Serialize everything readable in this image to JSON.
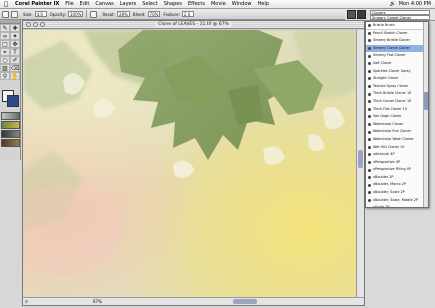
{
  "menubar": {
    "app": "Corel Painter IX",
    "items": [
      "File",
      "Edit",
      "Canvas",
      "Layers",
      "Select",
      "Shapes",
      "Effects",
      "Movie",
      "Window",
      "Help"
    ],
    "clock": "Mon 4:00 PM"
  },
  "propbar": {
    "size_label": "Size:",
    "size_value": "4.0",
    "opacity_label": "Opacity:",
    "opacity_value": "100%",
    "resat_label": "Resat:",
    "resat_value": "28%",
    "bleed_label": "Bleed:",
    "bleed_value": "70%",
    "feature_label": "Feature:",
    "feature_value": "2.0"
  },
  "brush_selector": {
    "category": "Cloners",
    "variant": "Smeary Camel Cloner"
  },
  "document": {
    "title": "Clone of LEAVES - 11.tif @ 67%",
    "zoom": "67%"
  },
  "brush_list": {
    "items": [
      "Bristle Brush",
      "Pencil Sketch Cloner",
      "Smeary Bristle Cloner",
      "Smeary Camel Cloner",
      "Smeary Flat Cloner",
      "Soft Cloner",
      "Sparkles Cloner Spray",
      "Straight Cloner",
      "Texture Spray Cloner",
      "Thick Bristle Cloner 10",
      "Thick Camel Cloner 10",
      "Thick Flat Cloner 10",
      "Van Gogh Cloner",
      "Watercolor Cloner",
      "Watercolor Run Cloner",
      "Watercolor Wash Cloner",
      "Wet Oils Cloner 10",
      "xAirbrush 4P",
      "xPerspective 4P",
      "xPerspective Filling 4P",
      "xBoulder 2P",
      "xBoulder, Marco 2P",
      "xBoulder, Scale 2P",
      "xBoulder, Scale, Rotate 2P",
      "xScale 2P"
    ],
    "selected_index": 3
  },
  "colors": {
    "main_color": "#f4f4f4",
    "additional_color": "#2a4a8a"
  }
}
